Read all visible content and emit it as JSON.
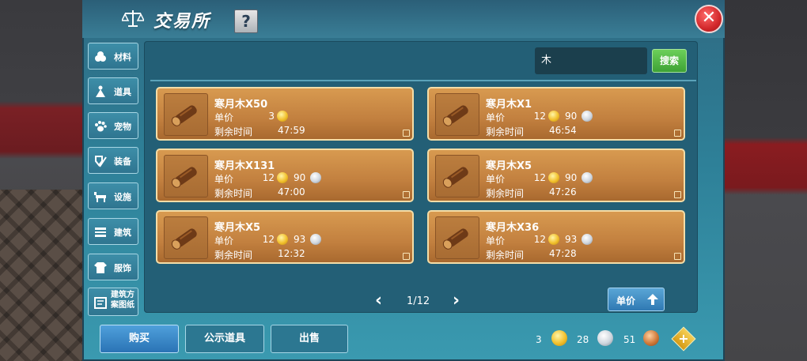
{
  "window": {
    "title": "交易所",
    "help_label": "?",
    "close_label": "✕"
  },
  "categories": [
    {
      "label": "材料",
      "icon": "materials-icon"
    },
    {
      "label": "道具",
      "icon": "props-icon"
    },
    {
      "label": "宠物",
      "icon": "pet-paw-icon"
    },
    {
      "label": "装备",
      "icon": "equipment-icon"
    },
    {
      "label": "设施",
      "icon": "facility-icon"
    },
    {
      "label": "建筑",
      "icon": "building-icon"
    },
    {
      "label": "服饰",
      "icon": "clothing-icon"
    },
    {
      "label": "建筑方案图纸",
      "icon": "blueprint-icon"
    }
  ],
  "search": {
    "value": "木",
    "button_label": "搜索"
  },
  "labels": {
    "unit_price": "单价",
    "time_left": "剩余时间"
  },
  "items": [
    {
      "name": "寒月木X50",
      "gold": "3",
      "silver": "",
      "time": "47:59"
    },
    {
      "name": "寒月木X1",
      "gold": "12",
      "silver": "90",
      "time": "46:54"
    },
    {
      "name": "寒月木X131",
      "gold": "12",
      "silver": "90",
      "time": "47:00"
    },
    {
      "name": "寒月木X5",
      "gold": "12",
      "silver": "90",
      "time": "47:26"
    },
    {
      "name": "寒月木X5",
      "gold": "12",
      "silver": "93",
      "time": "12:32"
    },
    {
      "name": "寒月木X36",
      "gold": "12",
      "silver": "93",
      "time": "47:28"
    }
  ],
  "pagination": {
    "prev": "‹",
    "next": "›",
    "page": "1/12"
  },
  "sort": {
    "label": "单价",
    "direction": "ascending"
  },
  "bottom": {
    "buy_label": "购买",
    "public_label": "公示道具",
    "sell_label": "出售"
  },
  "currency": {
    "gold": "3",
    "silver": "28",
    "copper": "51",
    "add_label": "+"
  },
  "colors": {
    "card": "#c8873f",
    "search_button": "#4fb844",
    "buy_button": "#2f7fc0",
    "close_button": "#d2282b"
  }
}
